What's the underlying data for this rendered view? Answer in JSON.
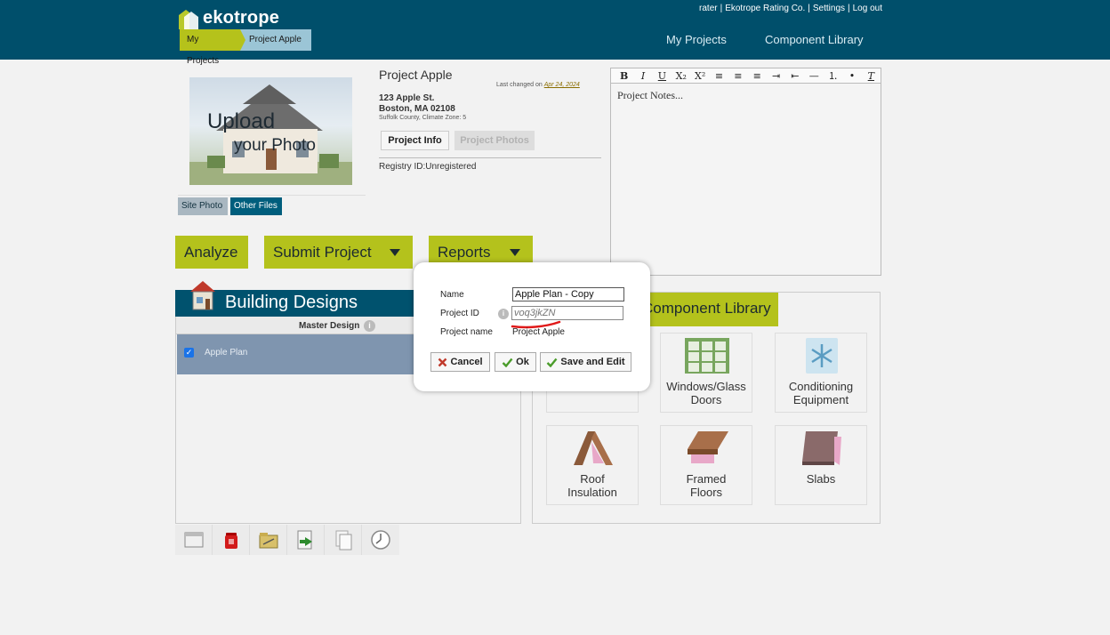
{
  "header": {
    "logo_text": "ekotrope",
    "top_links": [
      "rater",
      "Ekotrope Rating Co.",
      "Settings",
      "Log out"
    ],
    "breadcrumbs": [
      "My Projects",
      "Project Apple"
    ],
    "nav": [
      "My Projects",
      "Component Library"
    ],
    "colors": {
      "bar": "#004f6b",
      "accent": "#b4c21c"
    }
  },
  "project": {
    "photo_upload": "Upload",
    "photo_your_photo": "your Photo",
    "site_photo_btn": "Site Photo",
    "other_files_btn": "Other Files",
    "title": "Project Apple",
    "last_changed_prefix": "Last changed on",
    "last_changed_date": "Apr 24, 2024",
    "address_line1": "123 Apple St.",
    "address_line2": "Boston, MA 02108",
    "address_line3": "Suffolk County, Climate Zone: 5",
    "tab_info": "Project Info",
    "tab_photos": "Project Photos",
    "registry": "Registry ID:Unregistered"
  },
  "editor": {
    "toolbar": [
      "B",
      "I",
      "U",
      "X₂",
      "X²",
      "≡",
      "≡",
      "≡",
      "⇥",
      "⇤",
      "—",
      "⒈",
      "•",
      "T"
    ],
    "placeholder": "Project Notes..."
  },
  "actions": {
    "analyze": "Analyze",
    "submit": "Submit Project",
    "reports": "Reports"
  },
  "designs": {
    "title": "Building Designs",
    "column_header": "Master Design",
    "rows": [
      {
        "name": "Apple Plan",
        "checked": true
      }
    ]
  },
  "component_library": {
    "title": "Component Library",
    "tiles": [
      {
        "label_1": "Windows/Glass",
        "label_2": "Doors"
      },
      {
        "label_1": "Conditioning",
        "label_2": "Equipment"
      },
      {
        "label_1": "Roof",
        "label_2": "Insulation"
      },
      {
        "label_1": "Framed",
        "label_2": "Floors"
      },
      {
        "label_1": "Slabs",
        "label_2": ""
      }
    ]
  },
  "modal": {
    "name_label": "Name",
    "name_value": "Apple Plan - Copy",
    "project_id_label": "Project ID",
    "project_id_placeholder": "voq3jkZN",
    "project_name_label": "Project name",
    "project_name_value": "Project Apple",
    "cancel": "Cancel",
    "ok": "Ok",
    "save_edit": "Save and Edit"
  }
}
